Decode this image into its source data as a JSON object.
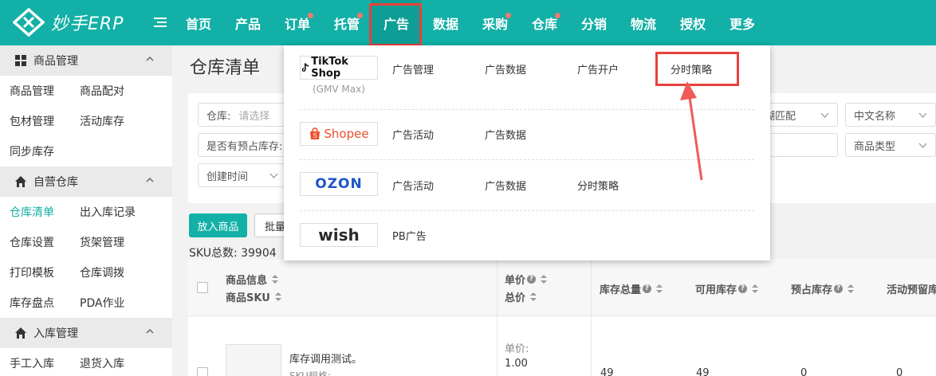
{
  "app": {
    "logo_text": "妙手ERP"
  },
  "nav": {
    "items": [
      {
        "label": "首页",
        "dot": false
      },
      {
        "label": "产品",
        "dot": false
      },
      {
        "label": "订单",
        "dot": true
      },
      {
        "label": "托管",
        "dot": true
      },
      {
        "label": "广告",
        "dot": false,
        "active": true
      },
      {
        "label": "数据",
        "dot": false
      },
      {
        "label": "采购",
        "dot": true
      },
      {
        "label": "仓库",
        "dot": true
      },
      {
        "label": "分销",
        "dot": false
      },
      {
        "label": "物流",
        "dot": false
      },
      {
        "label": "授权",
        "dot": false
      },
      {
        "label": "更多",
        "dot": false
      }
    ]
  },
  "sidebar": {
    "groups": [
      {
        "title": "商品管理",
        "icon": "box-icon",
        "rows": [
          [
            "商品管理",
            "商品配对"
          ],
          [
            "包材管理",
            "活动库存"
          ],
          [
            "同步库存",
            ""
          ]
        ]
      },
      {
        "title": "自营仓库",
        "icon": "home-icon",
        "rows": [
          [
            "仓库清单",
            "出入库记录"
          ],
          [
            "仓库设置",
            "货架管理"
          ],
          [
            "打印模板",
            "仓库调拨"
          ],
          [
            "库存盘点",
            "PDA作业"
          ]
        ]
      },
      {
        "title": "入库管理",
        "icon": "home-icon",
        "rows": [
          [
            "手工入库",
            "退货入库"
          ]
        ]
      }
    ],
    "active_item": "仓库清单"
  },
  "main": {
    "title": "仓库清单",
    "filters": {
      "warehouse_label": "仓库:",
      "warehouse_placeholder": "请选择",
      "reserved_label": "是否有预占库存:",
      "created_time": "创建时间",
      "fuzzy_match": "模糊匹配",
      "cn_name": "中文名称",
      "product_type": "商品类型"
    },
    "buttons": {
      "add_product": "放入商品",
      "batch": "批量"
    },
    "sku_total_label": "SKU总数:",
    "sku_total_value": "39904",
    "table": {
      "headers": {
        "product_info": "商品信息",
        "product_sku": "商品SKU",
        "unit_price": "单价",
        "total_price": "总价",
        "stock_total": "库存总量",
        "available": "可用库存",
        "reserved": "预占库存",
        "activity_reserved": "活动预留库"
      },
      "row": {
        "product_name": "库存调用测试。",
        "sku_spec": "SKU规格:",
        "unit_price_label": "单价:",
        "unit_price_value": "1.00",
        "stock_total": "49",
        "available": "49",
        "reserved": "0",
        "activity_reserved": "0"
      }
    }
  },
  "dropdown": {
    "tiktok": {
      "brand": "TikTok Shop",
      "sub": "(GMV Max)",
      "links": [
        "广告管理",
        "广告数据",
        "广告开户",
        "分时策略"
      ]
    },
    "shopee": {
      "brand": "Shopee",
      "links": [
        "广告活动",
        "广告数据"
      ]
    },
    "ozon": {
      "brand": "OZON",
      "links": [
        "广告活动",
        "广告数据",
        "分时策略"
      ]
    },
    "wish": {
      "brand": "wish",
      "links": [
        "PB广告"
      ]
    }
  },
  "colors": {
    "brand": "#12b0a6",
    "highlight": "#e8413c"
  }
}
